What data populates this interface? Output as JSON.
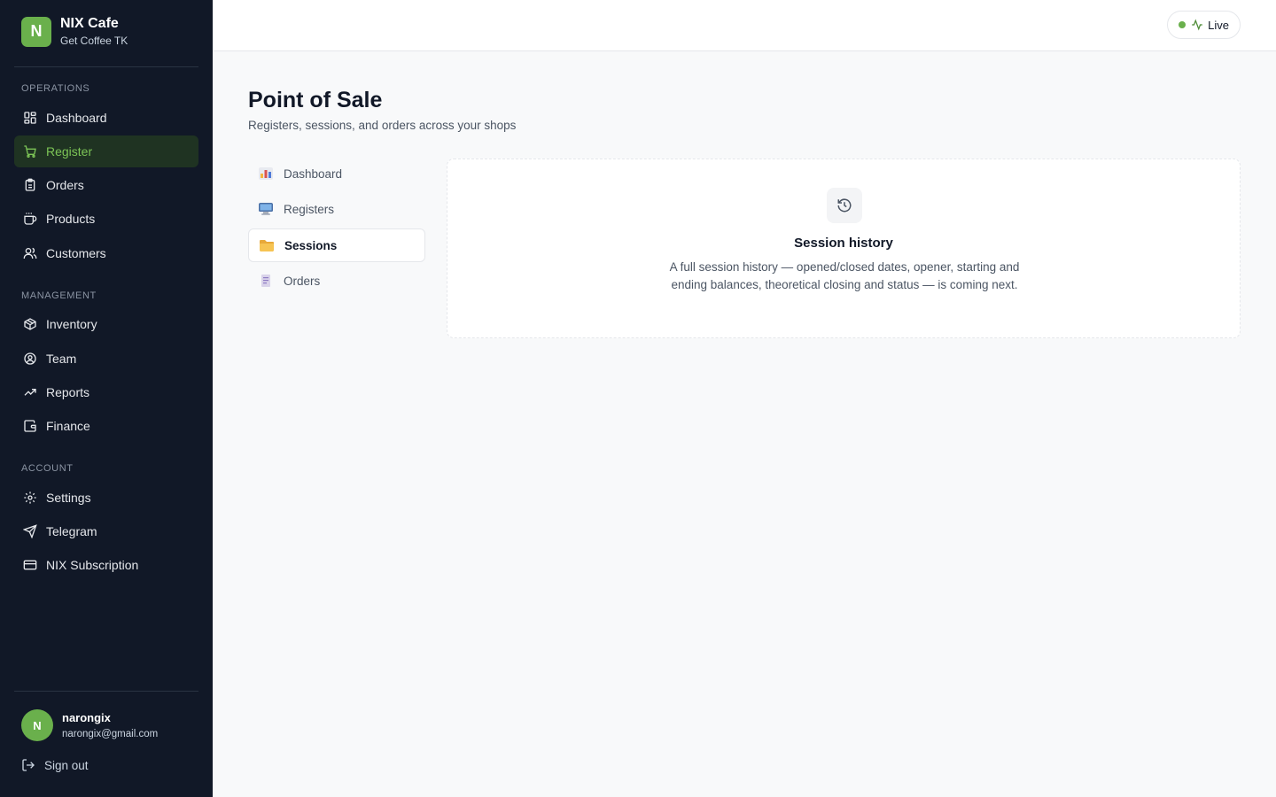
{
  "brand": {
    "logo_letter": "N",
    "name": "NIX Cafe",
    "subtitle": "Get Coffee TK"
  },
  "sidebar": {
    "sections": [
      {
        "label": "OPERATIONS",
        "items": [
          {
            "label": "Dashboard",
            "icon": "dashboard-icon"
          },
          {
            "label": "Register",
            "icon": "cart-icon",
            "active": true
          },
          {
            "label": "Orders",
            "icon": "clipboard-icon"
          },
          {
            "label": "Products",
            "icon": "coffee-icon"
          },
          {
            "label": "Customers",
            "icon": "users-icon"
          }
        ]
      },
      {
        "label": "MANAGEMENT",
        "items": [
          {
            "label": "Inventory",
            "icon": "package-icon"
          },
          {
            "label": "Team",
            "icon": "user-circle-icon"
          },
          {
            "label": "Reports",
            "icon": "trending-up-icon"
          },
          {
            "label": "Finance",
            "icon": "wallet-icon"
          }
        ]
      },
      {
        "label": "ACCOUNT",
        "items": [
          {
            "label": "Settings",
            "icon": "gear-icon"
          },
          {
            "label": "Telegram",
            "icon": "send-icon"
          },
          {
            "label": "NIX Subscription",
            "icon": "credit-card-icon"
          }
        ]
      }
    ]
  },
  "user": {
    "initial": "N",
    "name": "narongix",
    "email": "narongix@gmail.com",
    "signout_label": "Sign out"
  },
  "topbar": {
    "live_label": "Live"
  },
  "page": {
    "title": "Point of Sale",
    "subtitle": "Registers, sessions, and orders across your shops"
  },
  "subnav": [
    {
      "label": "Dashboard",
      "icon": "bar-chart-emoji-icon"
    },
    {
      "label": "Registers",
      "icon": "computer-emoji-icon"
    },
    {
      "label": "Sessions",
      "icon": "folder-emoji-icon",
      "active": true
    },
    {
      "label": "Orders",
      "icon": "receipt-emoji-icon"
    }
  ],
  "panel": {
    "icon": "history-icon",
    "title": "Session history",
    "description": "A full session history — opened/closed dates, opener, starting and ending balances, theoretical closing and status — is coming next."
  },
  "colors": {
    "accent": "#6ab04c",
    "sidebar_bg": "#111827",
    "active_bg": "#1f3322",
    "active_text": "#7cc456"
  }
}
